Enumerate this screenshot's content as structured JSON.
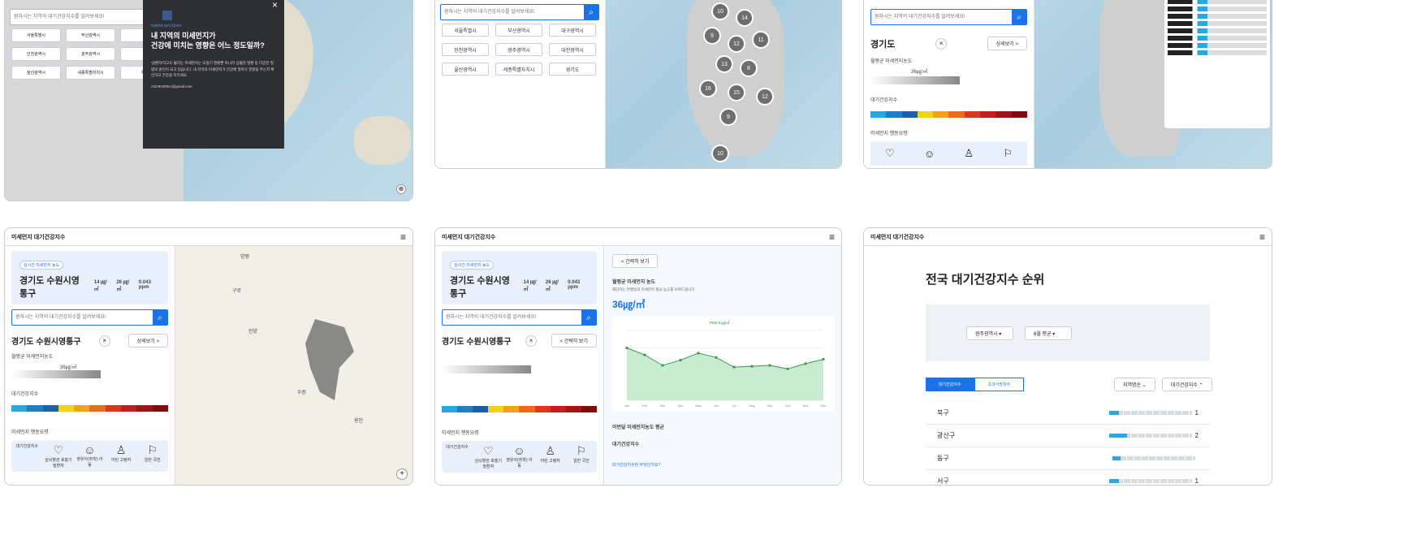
{
  "panel1": {
    "search_placeholder": "원하시는 지역의 대기건강지수를 알려보세요!",
    "cities": [
      "서울특별시",
      "부산광역시",
      "대",
      "인천광역시",
      "광주광역시",
      "대",
      "울산광역시",
      "세종특별자치시",
      "제주"
    ],
    "modal_tag": "미세먼지 대기건강지수",
    "modal_title_line1": "내 지역의 미세먼지가",
    "modal_title_line2": "건강에 미치는 영향은 어느 정도일까?",
    "modal_body": "'실환자'라고도 불리는 미세먼지는 호흡기 질환뿐 아니라 심혈관 질환 등 다양한 질병의 원인이 되고 있습니다. 내 지역의 미세먼지가 건강에 얼마나 영향을 주는지 확인하고 건강을 지키세요.",
    "modal_contact": "AGHKOREA@gmail.com",
    "close": "×"
  },
  "panel2": {
    "search_placeholder": "원하시는 지역의 대기건강지수를 알려보세요!",
    "cities": [
      "서울특별시",
      "부산광역시",
      "대구광역시",
      "인천광역시",
      "광주광역시",
      "대전광역시",
      "울산광역시",
      "세종특별자치시",
      "경기도"
    ],
    "bubbles": [
      "10",
      "14",
      "9",
      "12",
      "11",
      "13",
      "8",
      "16",
      "15",
      "12",
      "9",
      "10"
    ]
  },
  "panel3": {
    "search_placeholder": "원하시는 지역의 대기건강지수를 알려보세요!",
    "region": "경기도",
    "detail_btn": "상세보기 >",
    "label_avg": "월평균 미세먼지농도",
    "value": "36㎍/㎥",
    "label_index": "대기건강지수",
    "label_action": "미세먼지 행동요령"
  },
  "panel4": {
    "header": "미세먼지 대기건강지수",
    "tag": "실시간 미세먼지 농도",
    "region": "경기도 수원시영통구",
    "pm10": "14 ㎍/㎥",
    "pm25": "26 ㎍/㎥",
    "no2": "0.043 ppm",
    "search_placeholder": "원하시는 지역의 대기건강지수를 알려보세요!",
    "title": "경기도 수원시영통구",
    "detail_btn": "상세보기 >",
    "label_avg": "월평균 미세먼지농도",
    "avg_value": "36㎍/㎥",
    "label_index": "대기건강지수",
    "label_action": "미세먼지 행동요령",
    "action_items": [
      "대기건강지수",
      "심뇌혈관 호흡기질환자",
      "영유아(취학) 아동",
      "어린 고령자",
      "일반 국민"
    ],
    "map_labels": [
      "양평",
      "구로",
      "안양",
      "수원",
      "용인"
    ],
    "zoom": "+"
  },
  "panel5": {
    "header": "미세먼지 대기건강지수",
    "tag": "실시간 미세먼지 농도",
    "region": "경기도 수원시영통구",
    "pm10": "14 ㎍/㎥",
    "pm25": "26 ㎍/㎥",
    "no2": "0.043 ppm",
    "search_placeholder": "원하시는 지역의 대기건강지수를 알려보세요!",
    "title": "경기도 수원시영통구",
    "simple_btn": "< 간략히 보기",
    "right_btn": "< 간략히 보기",
    "chart_title": "월평균 미세먼지 농도",
    "chart_desc": "해당하는 연월일의 미세먼지 평균 농도를 보여드립니다.",
    "chart_value": "36㎍/㎥",
    "legend": "PM2.5 ㎍/㎥",
    "section1_title": "이번달 미세먼지농도 평균",
    "section2_title": "대기건강지수",
    "link": "대기건강지수란 무엇인가요?",
    "label_action": "미세먼지 행동요령",
    "action_items": [
      "대기건강지수",
      "심뇌혈관 호흡기질환자",
      "영유아(취학) 아동",
      "어린 고령자",
      "일반 국민"
    ]
  },
  "panel6": {
    "header": "미세먼지 대기건강지수",
    "title": "전국 대기건강지수 순위",
    "select1": "광주광역시",
    "select2": "6월 평균",
    "tab1": "대기건강지수",
    "tab2": "초과사망자수",
    "sort1": "지역명순",
    "sort2": "대기건강지수",
    "rows": [
      {
        "name": "북구",
        "rank": "1",
        "fill": 0.12
      },
      {
        "name": "광산구",
        "rank": "2",
        "fill": 0.22
      },
      {
        "name": "동구",
        "rank": "",
        "fill": 0.1
      },
      {
        "name": "서구",
        "rank": "1",
        "fill": 0.12
      }
    ]
  },
  "chart_data": {
    "type": "line",
    "series": [
      {
        "name": "PM2.5 ㎍/㎥",
        "values": [
          60,
          52,
          40,
          46,
          54,
          49,
          38,
          39,
          40,
          36,
          42,
          47
        ]
      }
    ],
    "x": [
      "Jan",
      "Feb",
      "Mar",
      "Apr",
      "May",
      "Jun",
      "Jul",
      "Aug",
      "Sep",
      "Oct",
      "Nov",
      "Dec"
    ],
    "ylim": [
      0,
      80
    ]
  },
  "colors": {
    "accent": "#1a73e8",
    "scale": [
      "#29a8e0",
      "#1f7fc4",
      "#1d5fa8",
      "#f2d21b",
      "#f4a11a",
      "#ef6b1a",
      "#e0351c",
      "#c61c1c",
      "#a31515",
      "#7e0d0d"
    ]
  }
}
